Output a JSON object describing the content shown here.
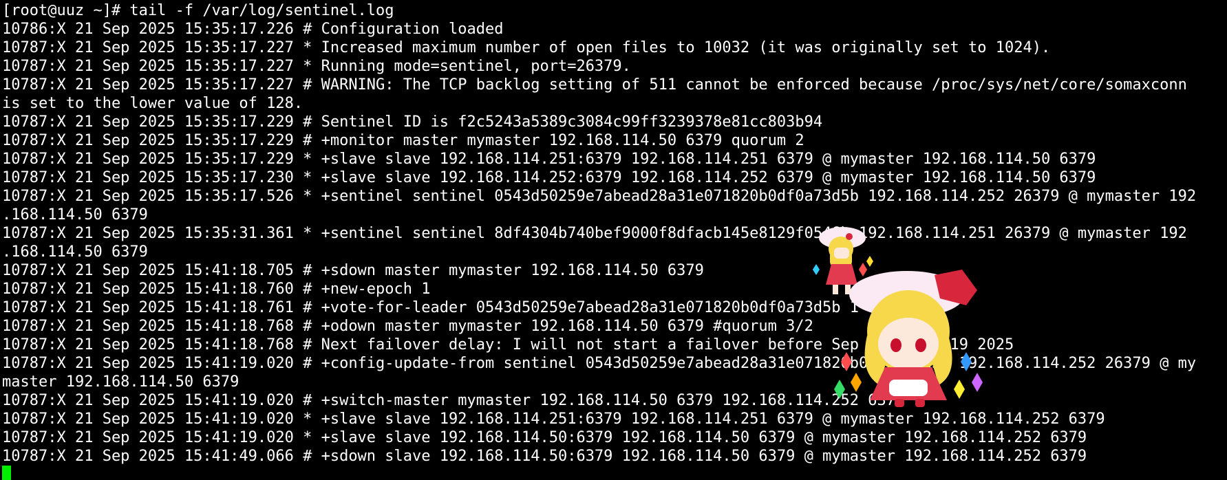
{
  "terminal": {
    "lines": [
      "[root@uuz ~]# tail -f /var/log/sentinel.log",
      "10786:X 21 Sep 2025 15:35:17.226 # Configuration loaded",
      "10787:X 21 Sep 2025 15:35:17.227 * Increased maximum number of open files to 10032 (it was originally set to 1024).",
      "10787:X 21 Sep 2025 15:35:17.227 * Running mode=sentinel, port=26379.",
      "10787:X 21 Sep 2025 15:35:17.227 # WARNING: The TCP backlog setting of 511 cannot be enforced because /proc/sys/net/core/somaxconn",
      "is set to the lower value of 128.",
      "10787:X 21 Sep 2025 15:35:17.229 # Sentinel ID is f2c5243a5389c3084c99ff3239378e81cc803b94",
      "10787:X 21 Sep 2025 15:35:17.229 # +monitor master mymaster 192.168.114.50 6379 quorum 2",
      "10787:X 21 Sep 2025 15:35:17.229 * +slave slave 192.168.114.251:6379 192.168.114.251 6379 @ mymaster 192.168.114.50 6379",
      "10787:X 21 Sep 2025 15:35:17.230 * +slave slave 192.168.114.252:6379 192.168.114.252 6379 @ mymaster 192.168.114.50 6379",
      "10787:X 21 Sep 2025 15:35:17.526 * +sentinel sentinel 0543d50259e7abead28a31e071820b0df0a73d5b 192.168.114.252 26379 @ mymaster 192",
      ".168.114.50 6379",
      "10787:X 21 Sep 2025 15:35:31.361 * +sentinel sentinel 8df4304b740bef9000f8dfacb145e8129f0546b 192.168.114.251 26379 @ mymaster 192",
      ".168.114.50 6379",
      "10787:X 21 Sep 2025 15:41:18.705 # +sdown master mymaster 192.168.114.50 6379",
      "10787:X 21 Sep 2025 15:41:18.760 # +new-epoch 1",
      "10787:X 21 Sep 2025 15:41:18.761 # +vote-for-leader 0543d50259e7abead28a31e071820b0df0a73d5b 1",
      "10787:X 21 Sep 2025 15:41:18.768 # +odown master mymaster 192.168.114.50 6379 #quorum 3/2",
      "10787:X 21 Sep 2025 15:41:18.768 # Next failover delay: I will not start a failover before Sep 21 15:47:19 2025",
      "10787:X 21 Sep 2025 15:41:19.020 # +config-update-from sentinel 0543d50259e7abead28a31e071820b0df0a73d5b 192.168.114.252 26379 @ my",
      "master 192.168.114.50 6379",
      "10787:X 21 Sep 2025 15:41:19.020 # +switch-master mymaster 192.168.114.50 6379 192.168.114.252 6379",
      "10787:X 21 Sep 2025 15:41:19.020 * +slave slave 192.168.114.251:6379 192.168.114.251 6379 @ mymaster 192.168.114.252 6379",
      "10787:X 21 Sep 2025 15:41:19.020 * +slave slave 192.168.114.50:6379 192.168.114.50 6379 @ mymaster 192.168.114.252 6379",
      "10787:X 21 Sep 2025 15:41:49.066 # +sdown slave 192.168.114.50:6379 192.168.114.50 6379 @ mymaster 192.168.114.252 6379"
    ],
    "colors": {
      "background": "#000000",
      "foreground": "#ffffff",
      "cursor": "#00ee00"
    }
  },
  "mascot": {
    "icon": "chibi-character-sprite",
    "colors": {
      "hair": "#f7d84a",
      "hat": "#fbe9f3",
      "ribbon": "#d8263c",
      "dress": "#e23a4e",
      "skin": "#fde8dc"
    }
  }
}
